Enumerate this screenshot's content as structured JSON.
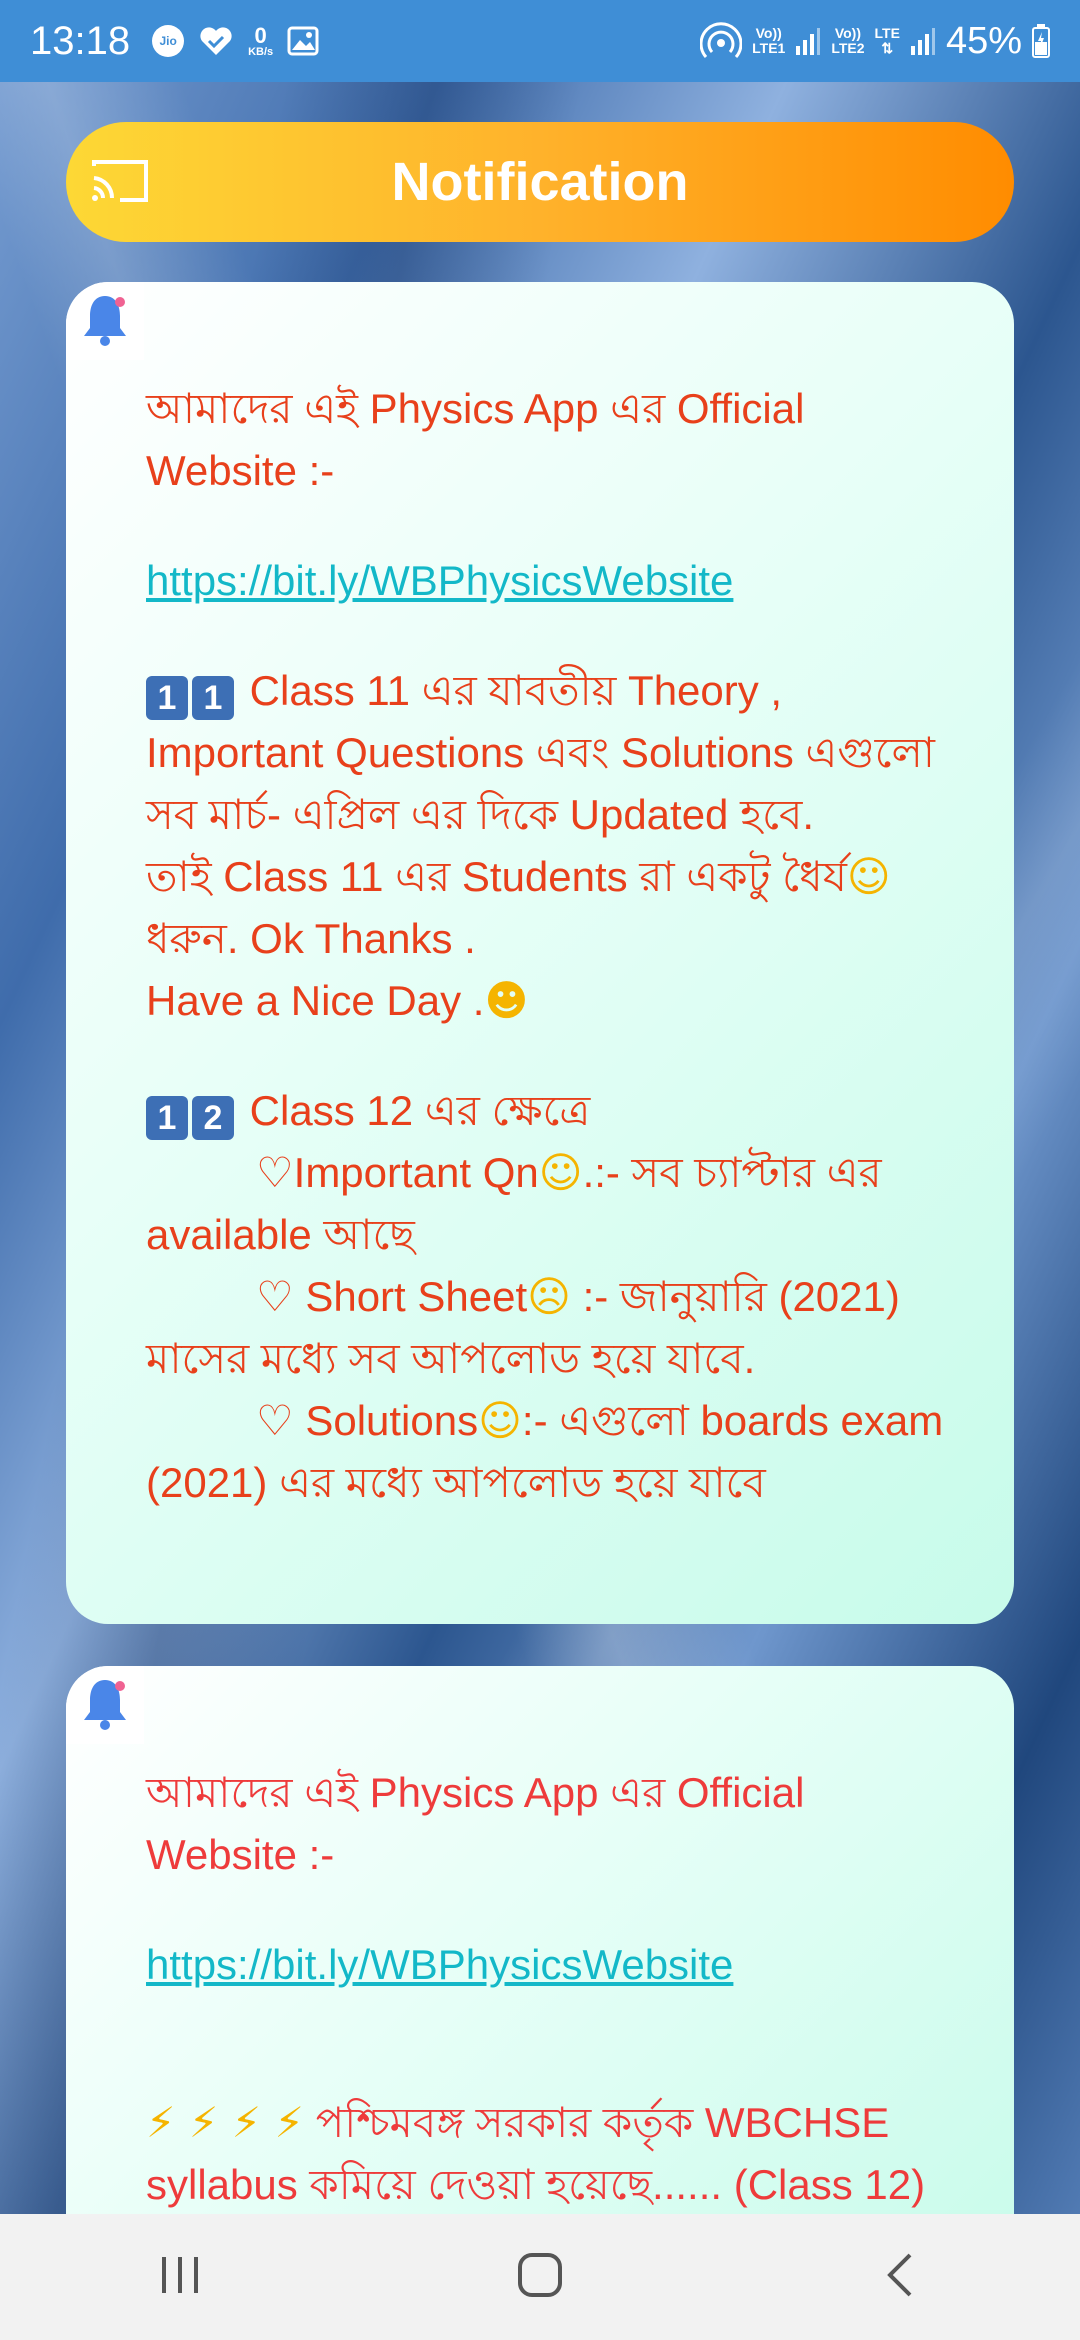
{
  "status_bar": {
    "time": "13:18",
    "carrier_icon_label": "Jio",
    "data_rate_value": "0",
    "data_rate_unit": "KB/s",
    "sim1_label_top": "Vo))",
    "sim1_label_bottom": "LTE1",
    "sim2_label_top": "Vo))",
    "sim2_label_bottom": "LTE2",
    "lte_label": "LTE",
    "battery_percent": "45%",
    "icons": [
      "jio-icon",
      "heart-check-icon",
      "image-icon",
      "hotspot-icon",
      "signal-icon",
      "battery-icon"
    ]
  },
  "header": {
    "title": "Notification",
    "icon": "cast-icon",
    "gradient": [
      "#fdd835",
      "#ff8c00"
    ]
  },
  "notifications": [
    {
      "icon": "bell-icon",
      "intro_line1": "আমাদের এই Physics App এর Official",
      "intro_line2": "Website :-",
      "link": "https://bit.ly/WBPhysicsWebsite",
      "block1": {
        "keycaps": [
          "1",
          "1"
        ],
        "line1": "Class 11 এর যাবতীয় Theory ,",
        "line2": "Important Questions এবং Solutions এগুলো",
        "line3": "সব মার্চ- এপ্রিল এর দিকে Updated হবে.",
        "line4": "তাই Class 11 এর Students রা একটু ধৈর্য",
        "line5": "ধরুন. Ok Thanks .",
        "line6": "Have a Nice Day ."
      },
      "block2": {
        "keycaps": [
          "1",
          "2"
        ],
        "line1": "Class 12 এর ক্ষেত্রে",
        "item1_a": "♡Important Qn",
        "item1_b": ".:- সব চ্যাপ্টার এর",
        "item1_c": "available আছে",
        "item2_a": "♡ Short Sheet",
        "item2_b": " :- জানুয়ারি (2021)",
        "item2_c": "মাসের মধ্যে সব আপলোড হয়ে যাবে.",
        "item3_a": "♡ Solutions",
        "item3_b": ":- এগুলো boards exam",
        "item3_c": "(2021) এর মধ্যে আপলোড হয়ে যাবে"
      },
      "emojis": {
        "neutral": "☺",
        "grin": "☻",
        "kiss": "☺",
        "roll": "☹",
        "smirk": "☺"
      }
    },
    {
      "icon": "bell-icon",
      "intro_line1": "আমাদের এই Physics App এর Official",
      "intro_line2": "Website :-",
      "link": "https://bit.ly/WBPhysicsWebsite",
      "bolts": "⚡ ⚡ ⚡ ⚡",
      "line1": "পশ্চিমবঙ্গ সরকার কর্তৃক WBCHSE",
      "line2": "syllabus কমিয়ে দেওয়া হয়েছে...... (Class 12)"
    }
  ],
  "colors": {
    "status_bar": "#3f8ed6",
    "card_text": "#e8401b",
    "link": "#13b8c8",
    "card_bg": "#c7fbea"
  },
  "nav": {
    "buttons": [
      "recents-icon",
      "home-icon",
      "back-icon"
    ]
  }
}
